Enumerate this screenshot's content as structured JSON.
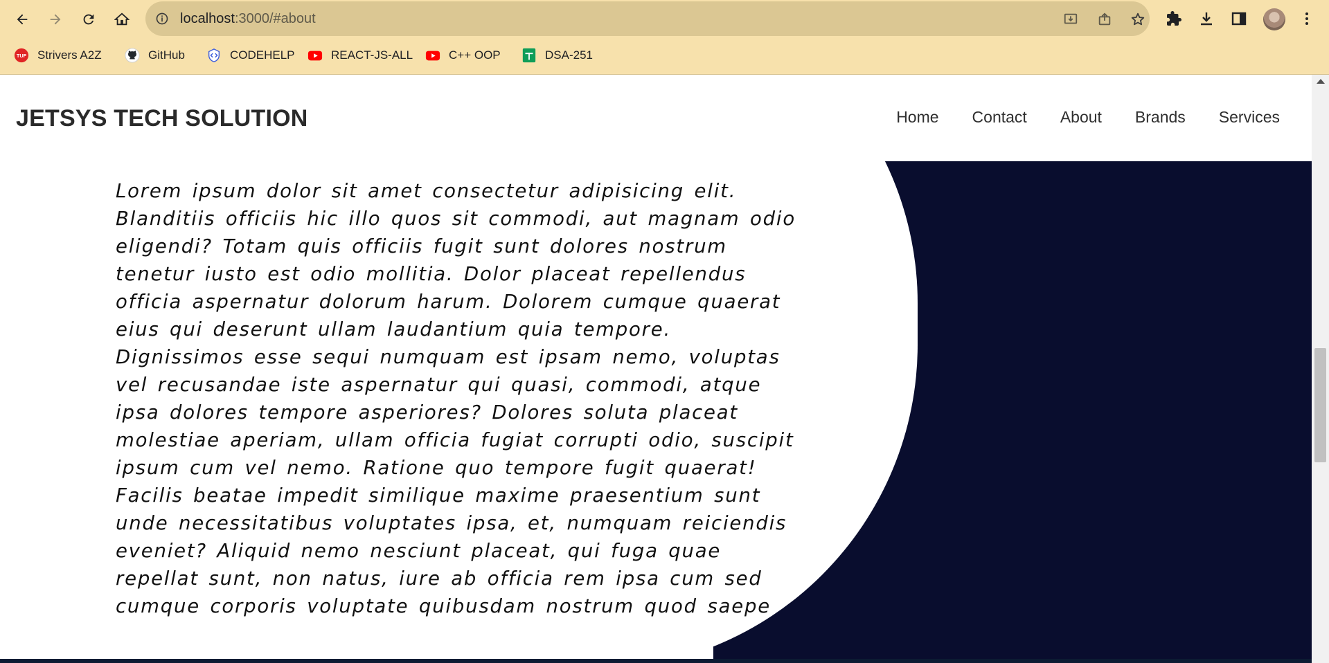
{
  "browser": {
    "url_host": "localhost",
    "url_path": ":3000/#about",
    "bookmarks": [
      {
        "label": "Strivers A2Z",
        "icon": "tuf-icon",
        "color": "#e02424"
      },
      {
        "label": "GitHub",
        "icon": "github-icon",
        "color": "#24292e"
      },
      {
        "label": "CODEHELP",
        "icon": "codehelp-icon",
        "color": "#3b5bdb"
      },
      {
        "label": "REACT-JS-ALL",
        "icon": "youtube-icon",
        "color": "#ff0000"
      },
      {
        "label": "C++ OOP",
        "icon": "youtube-icon",
        "color": "#ff0000"
      },
      {
        "label": "DSA-251",
        "icon": "sheets-icon",
        "color": "#0f9d58"
      }
    ],
    "toolbar_color": "#f7e1ac",
    "omnibox_color": "#dbc793"
  },
  "site": {
    "brand": "JETSYS TECH SOLUTION",
    "nav": [
      "Home",
      "Contact",
      "About",
      "Brands",
      "Services"
    ],
    "about_text": "Lorem ipsum dolor sit amet consectetur adipisicing elit. Blanditiis officiis hic illo quos sit commodi, aut magnam odio eligendi? Totam quis officiis fugit sunt dolores nostrum tenetur iusto est odio mollitia. Dolor placeat repellendus officia aspernatur dolorum harum. Dolorem cumque quaerat eius qui deserunt ullam laudantium quia tempore. Dignissimos esse sequi numquam est ipsam nemo, voluptas vel recusandae iste aspernatur qui quasi, commodi, atque ipsa dolores tempore asperiores? Dolores soluta placeat molestiae aperiam, ullam officia fugiat corrupti odio, suscipit ipsum cum vel nemo. Ratione quo tempore fugit quaerat! Facilis beatae impedit similique maxime praesentium sunt unde necessitatibus voluptates ipsa, et, numquam reiciendis eveniet? Aliquid nemo nesciunt placeat, qui fuga quae repellat sunt, non natus, iure ab officia rem ipsa cum sed cumque corporis voluptate quibusdam nostrum quod saepe",
    "dark_color": "#090d2e"
  }
}
